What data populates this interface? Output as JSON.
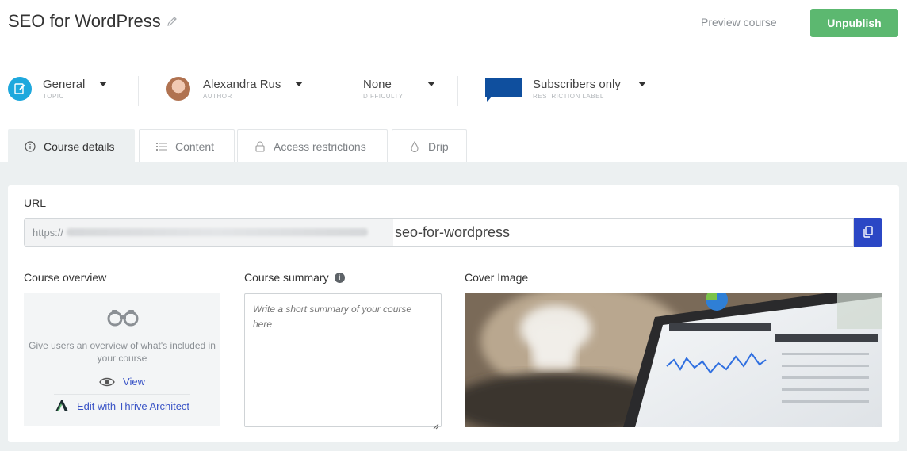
{
  "header": {
    "title": "SEO for WordPress",
    "preview_label": "Preview course",
    "unpublish_label": "Unpublish"
  },
  "meta": {
    "topic": {
      "value": "General",
      "label": "TOPIC"
    },
    "author": {
      "value": "Alexandra Rus",
      "label": "AUTHOR"
    },
    "difficulty": {
      "value": "None",
      "label": "DIFFICULTY"
    },
    "restriction": {
      "value": "Subscribers only",
      "label": "RESTRICTION LABEL"
    }
  },
  "tabs": [
    {
      "label": "Course details",
      "icon": "info-icon",
      "active": true
    },
    {
      "label": "Content",
      "icon": "list-icon",
      "active": false
    },
    {
      "label": "Access restrictions",
      "icon": "lock-icon",
      "active": false
    },
    {
      "label": "Drip",
      "icon": "drop-icon",
      "active": false
    }
  ],
  "details": {
    "url_label": "URL",
    "url_prefix": "https://",
    "url_slug": "seo-for-wordpress",
    "overview_label": "Course overview",
    "overview_desc": "Give users an overview of what's included in your course",
    "overview_view": "View",
    "overview_edit": "Edit with Thrive Architect",
    "summary_label": "Course summary",
    "summary_placeholder": "Write a short summary of your course here",
    "cover_label": "Cover Image"
  },
  "colors": {
    "accent_green": "#5cb870",
    "accent_blue": "#2b47c5",
    "link_blue": "#3a54c6",
    "topic_blue": "#1ea8dd",
    "flag_blue": "#0f4f9e"
  }
}
